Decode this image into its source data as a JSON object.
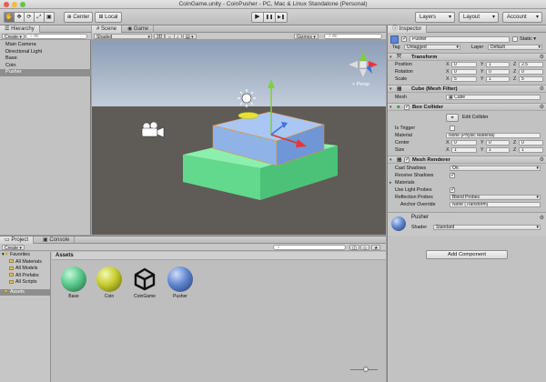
{
  "window": {
    "title": "CoinGame.unity - CoinPusher - PC, Mac & Linux Standalone (Personal)"
  },
  "toolbar": {
    "tools": [
      "hand-tool",
      "move-tool",
      "rotate-tool",
      "scale-tool",
      "rect-tool"
    ],
    "pivot_label": "Center",
    "space_label": "Local",
    "play_icon": "▶",
    "pause_icon": "❚❚",
    "step_icon": "▶❚",
    "layers_label": "Layers",
    "layout_label": "Layout",
    "account_label": "Account"
  },
  "hierarchy": {
    "tab_label": "Hierarchy",
    "create_label": "Create",
    "search_placeholder": "All",
    "items": [
      "Main Camera",
      "Directional Light",
      "Base",
      "Coin",
      "Pusher"
    ],
    "selected_index": 4
  },
  "scene": {
    "tab_scene": "Scene",
    "tab_game": "Game",
    "shading_mode": "Shaded",
    "mode_2d": "2D",
    "gizmos_label": "Gizmos",
    "search_placeholder": "All",
    "persp_label": "Persp",
    "colors": {
      "sky": "#a7b7cf",
      "ground": "#5e5a55",
      "base": "#7fe6a4",
      "pusher": "#8fb4e8",
      "coin": "#e6e233"
    }
  },
  "project": {
    "tab_project": "Project",
    "tab_console": "Console",
    "create_label": "Create",
    "favorites_label": "Favorites",
    "favorites": [
      "All Materials",
      "All Models",
      "All Prefabs",
      "All Scripts"
    ],
    "assets_root": "Assets",
    "breadcrumb": "Assets",
    "assets": [
      {
        "name": "Base",
        "kind": "material",
        "color": "#57c98a"
      },
      {
        "name": "Coin",
        "kind": "material",
        "color": "#c5cc2c"
      },
      {
        "name": "CoinGame",
        "kind": "scene"
      },
      {
        "name": "Pusher",
        "kind": "material",
        "color": "#5f86cf"
      }
    ]
  },
  "inspector": {
    "tab_label": "Inspector",
    "object_name": "Pusher",
    "static_label": "Static",
    "tag_label": "Tag",
    "tag_value": "Untagged",
    "layer_label": "Layer",
    "layer_value": "Default",
    "transform": {
      "title": "Transform",
      "position_label": "Position",
      "rotation_label": "Rotation",
      "scale_label": "Scale",
      "position": [
        "0",
        "1",
        "2.5"
      ],
      "rotation": [
        "0",
        "0",
        "0"
      ],
      "scale": [
        "5",
        "1",
        "5"
      ]
    },
    "mesh_filter": {
      "title": "Cube (Mesh Filter)",
      "mesh_label": "Mesh",
      "mesh_value": "Cube"
    },
    "box_collider": {
      "title": "Box Collider",
      "edit_label": "Edit Collider",
      "is_trigger_label": "Is Trigger",
      "material_label": "Material",
      "material_value": "None (Physic Material)",
      "center_label": "Center",
      "center": [
        "0",
        "0",
        "0"
      ],
      "size_label": "Size",
      "size": [
        "1",
        "1",
        "1"
      ]
    },
    "mesh_renderer": {
      "title": "Mesh Renderer",
      "cast_shadows_label": "Cast Shadows",
      "cast_shadows_value": "On",
      "receive_shadows_label": "Receive Shadows",
      "materials_label": "Materials",
      "light_probes_label": "Use Light Probes",
      "reflection_probes_label": "Reflection Probes",
      "reflection_probes_value": "Blend Probes",
      "anchor_override_label": "Anchor Override",
      "anchor_override_value": "None (Transform)"
    },
    "material": {
      "name": "Pusher",
      "shader_label": "Shader",
      "shader_value": "Standard",
      "color": "#5f86cf"
    },
    "add_component_label": "Add Component",
    "axis_labels": [
      "X",
      "Y",
      "Z"
    ]
  }
}
